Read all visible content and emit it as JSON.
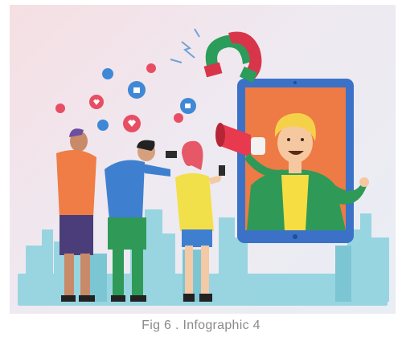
{
  "caption": "Fig 6 . Infographic 4",
  "colors": {
    "background": "#f3e6ea",
    "skyline": "#8fd3df",
    "tablet_frame": "#3b72c7",
    "tablet_screen": "#ee7a45",
    "magnet_red": "#d8354a",
    "magnet_green": "#2b9c5a",
    "heart_bubble": "#e84e63",
    "like_bubble": "#3f88d6"
  },
  "icons": [
    "heart-bubble-icon",
    "thumbs-up-bubble-icon",
    "magnet-icon",
    "megaphone-icon",
    "tablet-icon",
    "smartphone-icon"
  ]
}
